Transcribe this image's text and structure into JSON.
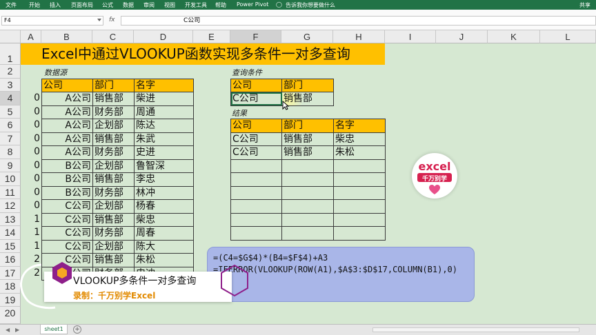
{
  "ribbon": {
    "items": [
      "文件",
      "开始",
      "插入",
      "页面布局",
      "公式",
      "数据",
      "审阅",
      "视图",
      "开发工具",
      "帮助",
      "Power Pivot",
      "告诉我你想要做什么",
      "共享"
    ]
  },
  "formula_bar": {
    "name_box": "F4",
    "fx": "fx",
    "value": "C公司"
  },
  "columns": [
    "A",
    "B",
    "C",
    "D",
    "E",
    "F",
    "G",
    "H",
    "I",
    "J",
    "K",
    "L"
  ],
  "rows": [
    "1",
    "2",
    "3",
    "4",
    "5",
    "6",
    "7",
    "8",
    "9",
    "10",
    "11",
    "12",
    "13",
    "14",
    "15",
    "16",
    "17",
    "18",
    "19",
    "20"
  ],
  "title": "Excel中通过VLOOKUP函数实现多条件一对多查询",
  "source_label": "数据源",
  "query_label": "查询条件",
  "result_label": "结果",
  "col_a_values": [
    "0",
    "0",
    "0",
    "0",
    "0",
    "0",
    "0",
    "0",
    "0",
    "1",
    "1",
    "1",
    "2",
    "2"
  ],
  "source_table": {
    "headers": [
      "公司",
      "部门",
      "名字"
    ],
    "rows": [
      [
        "A公司",
        "销售部",
        "柴进"
      ],
      [
        "A公司",
        "财务部",
        "周通"
      ],
      [
        "A公司",
        "企划部",
        "陈达"
      ],
      [
        "A公司",
        "销售部",
        "朱武"
      ],
      [
        "A公司",
        "财务部",
        "史进"
      ],
      [
        "B公司",
        "企划部",
        "鲁智深"
      ],
      [
        "B公司",
        "销售部",
        "李忠"
      ],
      [
        "B公司",
        "财务部",
        "林冲"
      ],
      [
        "C公司",
        "企划部",
        "杨春"
      ],
      [
        "C公司",
        "销售部",
        "柴忠"
      ],
      [
        "C公司",
        "财务部",
        "周春"
      ],
      [
        "C公司",
        "企划部",
        "陈大"
      ],
      [
        "C公司",
        "销售部",
        "朱松"
      ],
      [
        "C公司",
        "财务部",
        "史冲"
      ]
    ]
  },
  "query_table": {
    "headers": [
      "公司",
      "部门"
    ],
    "values": [
      "C公司",
      "销售部"
    ]
  },
  "result_table": {
    "headers": [
      "公司",
      "部门",
      "名字"
    ],
    "rows": [
      [
        "C公司",
        "销售部",
        "柴忠"
      ],
      [
        "C公司",
        "销售部",
        "朱松"
      ],
      [
        "",
        "",
        ""
      ],
      [
        "",
        "",
        ""
      ],
      [
        "",
        "",
        ""
      ],
      [
        "",
        "",
        ""
      ],
      [
        "",
        "",
        ""
      ],
      [
        "",
        "",
        ""
      ]
    ]
  },
  "formulas": {
    "line1": "=(C4=$G$4)*(B4=$F$4)+A3",
    "line2": "=IFERROR(VLOOKUP(ROW(A1),$A$3:$D$17,COLUMN(B1),0)",
    "line3": ",\"\")"
  },
  "caption": {
    "title": "VLOOKUP多条件一对多查询",
    "subtitle": "录制：千万别学Excel"
  },
  "logo": {
    "line1": "excel",
    "line2": "千万别学"
  },
  "sheet": {
    "tab": "sheet1",
    "add": "+"
  },
  "colors": {
    "ribbon": "#217346",
    "header_fill": "#ffc000",
    "sheet_bg": "#d6e8d2",
    "formula_box": "#a9b6e8"
  }
}
